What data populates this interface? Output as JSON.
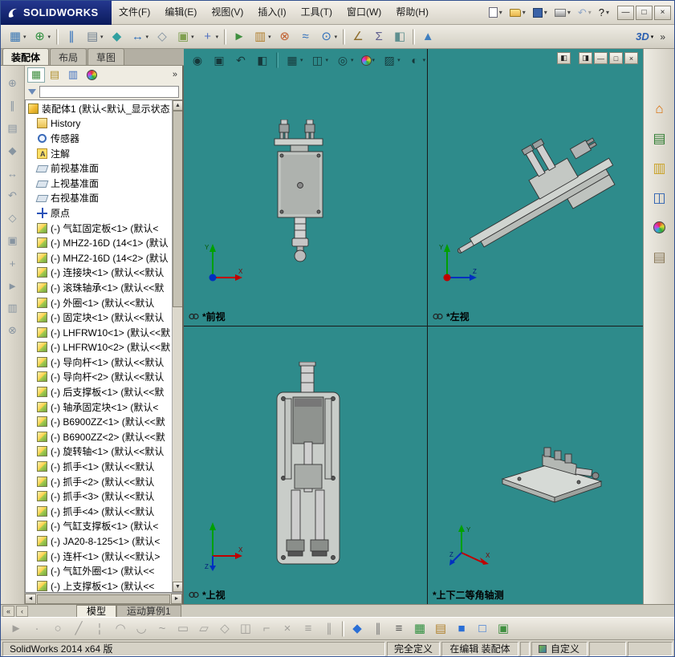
{
  "titlebar": {
    "logo_text": "SOLIDWORKS",
    "menus": [
      "文件(F)",
      "编辑(E)",
      "视图(V)",
      "插入(I)",
      "工具(T)",
      "窗口(W)",
      "帮助(H)"
    ],
    "quick": [
      {
        "n": "new-document",
        "cls": "pg",
        "ch": true
      },
      {
        "n": "open-document",
        "cls": "fold",
        "ch": true
      },
      {
        "n": "save-document",
        "cls": "save",
        "ch": true
      },
      {
        "n": "print-document",
        "cls": "print",
        "ch": true
      },
      {
        "n": "undo",
        "cls": "disabled",
        "g": "↶",
        "c": "#2a5fb0",
        "ch": true
      },
      {
        "n": "help",
        "g": "?",
        "c": "#111",
        "ch": true
      }
    ],
    "window_buttons": [
      {
        "n": "minimize-button",
        "g": "—"
      },
      {
        "n": "restore-button",
        "g": "□"
      },
      {
        "n": "close-button",
        "g": "×"
      }
    ]
  },
  "main_toolbar": {
    "items": [
      {
        "n": "assembly-layout",
        "g": "▦",
        "c": "#3b78b5",
        "ch": true
      },
      {
        "n": "insert-components",
        "g": "⊕",
        "c": "#2f8f3f",
        "ch": true
      },
      {
        "n": "separator",
        "cls": "sep"
      },
      {
        "n": "mate",
        "g": "∥",
        "c": "#2f6fbb"
      },
      {
        "n": "linear-component-pattern",
        "g": "▤",
        "c": "#6f7f8f",
        "ch": true
      },
      {
        "n": "smart-fasteners",
        "g": "◆",
        "c": "#2f9f9f"
      },
      {
        "n": "move-component",
        "g": "↔",
        "c": "#2f6fbb",
        "ch": true
      },
      {
        "n": "show-hidden-components",
        "g": "◇",
        "c": "#7f8f9f"
      },
      {
        "n": "assembly-features",
        "g": "▣",
        "c": "#7f9f4f",
        "ch": true
      },
      {
        "n": "reference-geometry",
        "g": "+",
        "c": "#4f6fbf",
        "ch": true
      },
      {
        "n": "separator",
        "cls": "sep"
      },
      {
        "n": "new-motion-study",
        "g": "►",
        "c": "#3f8f3f"
      },
      {
        "n": "bill-of-materials",
        "g": "▥",
        "c": "#b07f2f",
        "ch": true
      },
      {
        "n": "exploded-view",
        "g": "⊗",
        "c": "#c05f2f"
      },
      {
        "n": "explode-line-sketch",
        "g": "≈",
        "c": "#2f6fbb"
      },
      {
        "n": "interference-detection",
        "g": "⊙",
        "c": "#2f6fbb",
        "ch": true
      },
      {
        "n": "separator",
        "cls": "sep"
      },
      {
        "n": "measure",
        "g": "∠",
        "c": "#8f6f2f"
      },
      {
        "n": "mass-properties",
        "g": "Σ",
        "c": "#5f5f8f"
      },
      {
        "n": "section-properties",
        "g": "◧",
        "c": "#5f8f8f"
      },
      {
        "n": "separator",
        "cls": "sep"
      },
      {
        "n": "instant-3d",
        "g": "▲",
        "c": "#3f7fbf"
      }
    ],
    "overflow": {
      "label": "3D",
      "chev": "▾",
      "more": "»"
    }
  },
  "left_tabs": [
    {
      "label": "装配体",
      "cls": "active"
    },
    {
      "label": "布局"
    },
    {
      "label": "草图"
    }
  ],
  "left_strip": [
    {
      "n": "insert-component",
      "g": "⊕"
    },
    {
      "n": "mate",
      "g": "∥"
    },
    {
      "n": "component-pattern",
      "g": "▤"
    },
    {
      "n": "smart-fasteners",
      "g": "◆"
    },
    {
      "n": "move-component",
      "g": "↔"
    },
    {
      "n": "rotate-component",
      "g": "↶"
    },
    {
      "n": "show-hide-components",
      "g": "◇"
    },
    {
      "n": "assembly-features",
      "g": "▣"
    },
    {
      "n": "reference-geometry",
      "g": "+"
    },
    {
      "n": "motion-study",
      "g": "►"
    },
    {
      "n": "bill-of-materials",
      "g": "▥"
    },
    {
      "n": "exploded-view",
      "g": "⊗"
    }
  ],
  "panel": {
    "header": [
      {
        "n": "featuremanager-tree-tab",
        "g": "▦",
        "c": "#3f8f3f",
        "cls": "active"
      },
      {
        "n": "propertymanager-tab",
        "g": "▤",
        "c": "#b08f2f"
      },
      {
        "n": "configurationmanager-tab",
        "g": "▥",
        "c": "#3f6fbf"
      },
      {
        "n": "displaymanager-tab",
        "cls": "ball"
      }
    ],
    "header_more": "»",
    "filter_value": "",
    "tree": {
      "root": {
        "icon": "assembly",
        "label": "装配体1 (默认<默认_显示状态"
      },
      "items": [
        {
          "icon": "history",
          "label": "History"
        },
        {
          "icon": "sensors",
          "label": "传感器"
        },
        {
          "icon": "annotations",
          "label": "注解"
        },
        {
          "icon": "plane",
          "label": "前视基准面"
        },
        {
          "icon": "plane",
          "label": "上视基准面"
        },
        {
          "icon": "plane",
          "label": "右视基准面"
        },
        {
          "icon": "origin",
          "label": "原点"
        },
        {
          "icon": "part",
          "label": "(-) 气缸固定板<1> (默认<"
        },
        {
          "icon": "part",
          "label": "(-) MHZ2-16D (14<1> (默认"
        },
        {
          "icon": "part",
          "label": "(-) MHZ2-16D (14<2> (默认"
        },
        {
          "icon": "part",
          "label": "(-) 连接块<1> (默认<<默认"
        },
        {
          "icon": "part",
          "label": "(-) 滚珠轴承<1> (默认<<默"
        },
        {
          "icon": "part",
          "label": "(-) 外圈<1> (默认<<默认"
        },
        {
          "icon": "part",
          "label": "(-) 固定块<1> (默认<<默认"
        },
        {
          "icon": "part",
          "label": "(-) LHFRW10<1> (默认<<默"
        },
        {
          "icon": "part",
          "label": "(-) LHFRW10<2> (默认<<默"
        },
        {
          "icon": "part",
          "label": "(-) 导向杆<1> (默认<<默认"
        },
        {
          "icon": "part",
          "label": "(-) 导向杆<2> (默认<<默认"
        },
        {
          "icon": "part",
          "label": "(-) 后支撑板<1> (默认<<默"
        },
        {
          "icon": "part",
          "label": "(-) 轴承固定块<1> (默认<"
        },
        {
          "icon": "part",
          "label": "(-) B6900ZZ<1> (默认<<默"
        },
        {
          "icon": "part",
          "label": "(-) B6900ZZ<2> (默认<<默"
        },
        {
          "icon": "part",
          "label": "(-) 旋转轴<1> (默认<<默认"
        },
        {
          "icon": "part",
          "label": "(-) 抓手<1> (默认<<默认"
        },
        {
          "icon": "part",
          "label": "(-) 抓手<2> (默认<<默认"
        },
        {
          "icon": "part",
          "label": "(-) 抓手<3> (默认<<默认"
        },
        {
          "icon": "part",
          "label": "(-) 抓手<4> (默认<<默认"
        },
        {
          "icon": "part",
          "label": "(-) 气缸支撑板<1> (默认<"
        },
        {
          "icon": "part",
          "label": "(-) JA20-8-125<1> (默认<"
        },
        {
          "icon": "part",
          "label": "(-) 连杆<1> (默认<<默认>"
        },
        {
          "icon": "part",
          "label": "(-) 气缸外圈<1> (默认<<"
        },
        {
          "icon": "part",
          "label": "(-) 上支撑板<1> (默认<<"
        }
      ]
    }
  },
  "hud": [
    {
      "n": "zoom-to-fit",
      "g": "◉"
    },
    {
      "n": "zoom-to-area",
      "g": "▣"
    },
    {
      "n": "previous-view",
      "g": "↶"
    },
    {
      "n": "section-view",
      "g": "◧"
    },
    {
      "n": "separator",
      "cls": "sep"
    },
    {
      "n": "view-orientation",
      "g": "▦",
      "ch": true
    },
    {
      "n": "display-style",
      "g": "◫",
      "ch": true
    },
    {
      "n": "hide-show-items",
      "g": "◎",
      "ch": true
    },
    {
      "n": "edit-appearance",
      "cls": "ball",
      "ch": true
    },
    {
      "n": "apply-scene",
      "g": "▨",
      "ch": true
    },
    {
      "n": "view-settings",
      "g": "◐",
      "ch": true
    }
  ],
  "viewport_buttons": [
    {
      "n": "viewport-layout-left",
      "g": "◧"
    },
    {
      "n": "viewport-layout-right",
      "g": "◨"
    },
    {
      "n": "minimize-document",
      "g": "—"
    },
    {
      "n": "restore-document",
      "g": "□"
    },
    {
      "n": "close-document",
      "g": "×"
    }
  ],
  "viewports": [
    {
      "label": "*前视"
    },
    {
      "label": "*左视"
    },
    {
      "label": "*上视"
    },
    {
      "label": "*上下二等角轴测"
    }
  ],
  "task_pane": [
    {
      "n": "solidworks-resources",
      "g": "⌂",
      "c": "#d96b00"
    },
    {
      "n": "design-library",
      "g": "▤",
      "c": "#2f7d32"
    },
    {
      "n": "file-explorer",
      "g": "▥",
      "c": "#c9a227"
    },
    {
      "n": "view-palette",
      "g": "◫",
      "c": "#2a5fb0"
    },
    {
      "n": "appearances-scenes",
      "cls": "ball"
    },
    {
      "n": "custom-properties",
      "g": "▤",
      "c": "#8a7a5a"
    }
  ],
  "bottom_tabs": {
    "nav": [
      {
        "n": "scroll-first",
        "g": "«"
      },
      {
        "n": "scroll-left",
        "g": "‹"
      }
    ],
    "tabs": [
      {
        "label": "模型",
        "cls": "active"
      },
      {
        "label": "运动算例1"
      }
    ]
  },
  "sketch_toolbar": [
    {
      "n": "select",
      "g": "►",
      "cls": "disabled"
    },
    {
      "n": "sketch-point",
      "g": "·",
      "cls": "disabled"
    },
    {
      "n": "circle",
      "g": "○",
      "cls": "disabled"
    },
    {
      "n": "line",
      "g": "╱",
      "cls": "disabled"
    },
    {
      "n": "centerline",
      "g": "¦",
      "cls": "disabled"
    },
    {
      "n": "arc",
      "g": "◠",
      "cls": "disabled"
    },
    {
      "n": "tangent-arc",
      "g": "◡",
      "cls": "disabled"
    },
    {
      "n": "spline",
      "g": "~",
      "cls": "disabled"
    },
    {
      "n": "rectangle",
      "g": "▭",
      "cls": "disabled"
    },
    {
      "n": "parallelogram",
      "g": "▱",
      "cls": "disabled"
    },
    {
      "n": "polygon",
      "g": "◇",
      "cls": "disabled"
    },
    {
      "n": "mirror-entities",
      "g": "◫",
      "cls": "disabled"
    },
    {
      "n": "fillet",
      "g": "⌐",
      "cls": "disabled"
    },
    {
      "n": "trim-entities",
      "g": "×",
      "cls": "disabled"
    },
    {
      "n": "convert-entities",
      "g": "≡",
      "cls": "disabled"
    },
    {
      "n": "offset-entities",
      "g": "∥",
      "cls": "disabled"
    },
    {
      "n": "separator",
      "cls": "sep"
    },
    {
      "n": "smart-dimension",
      "g": "◆",
      "c": "#2a6fd6"
    },
    {
      "n": "attachments",
      "g": "∥",
      "c": "#7a7a7a"
    },
    {
      "n": "line-format",
      "g": "≡",
      "c": "#555555"
    },
    {
      "n": "grid-system",
      "g": "▦",
      "c": "#2f8f3f"
    },
    {
      "n": "tables",
      "g": "▤",
      "c": "#b0822f"
    },
    {
      "n": "sketch",
      "g": "■",
      "c": "#2a6fd6"
    },
    {
      "n": "3d-sketch",
      "g": "□",
      "c": "#2a6fd6"
    },
    {
      "n": "exit-sketch",
      "g": "▣",
      "c": "#3f8f3f"
    }
  ],
  "statusbar": {
    "app": "SolidWorks 2014 x64 版",
    "define_state": "完全定义",
    "edit_state": "在编辑 装配体",
    "custom": "自定义"
  }
}
